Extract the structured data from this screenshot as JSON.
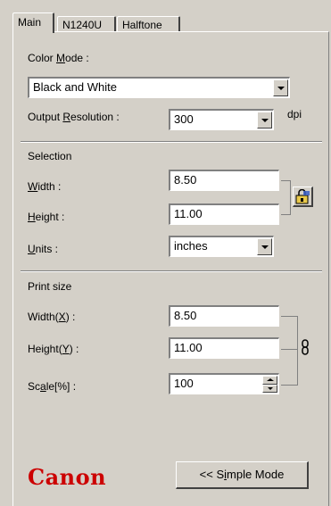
{
  "tabs": [
    {
      "label": "Main",
      "active": true
    },
    {
      "label": "N1240U",
      "active": false
    },
    {
      "label": "Halftone",
      "active": false
    }
  ],
  "color_mode": {
    "label": "Color Mode :",
    "value": "Black and White"
  },
  "output_resolution": {
    "label": "Output Resolution :",
    "value": "300",
    "unit": "dpi"
  },
  "selection": {
    "heading": "Selection",
    "width_label": "Width :",
    "width_value": "8.50",
    "height_label": "Height :",
    "height_value": "11.00",
    "units_label": "Units :",
    "units_value": "inches",
    "lock_icon": "lock-icon"
  },
  "print_size": {
    "heading": "Print size",
    "width_label": "Width(X) :",
    "width_value": "8.50",
    "height_label": "Height(Y) :",
    "height_value": "11.00",
    "scale_label": "Scale[%] :",
    "scale_value": "100",
    "link_icon": "chain-link-icon"
  },
  "brand": {
    "logo_text": "Canon",
    "color": "#cc0000"
  },
  "simple_mode_button": "<< Simple Mode"
}
